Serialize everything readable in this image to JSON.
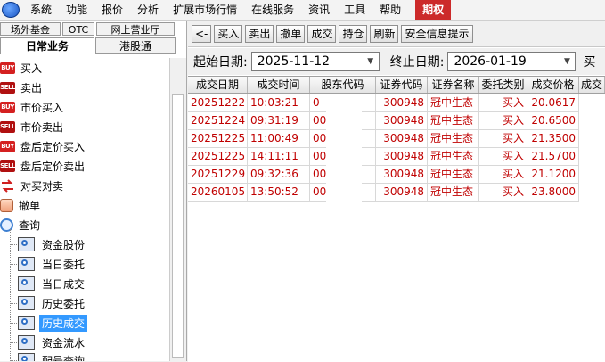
{
  "menu": {
    "items": [
      "系统",
      "功能",
      "报价",
      "分析",
      "扩展市场行情",
      "在线服务",
      "资讯",
      "工具",
      "帮助"
    ],
    "active": "期权"
  },
  "left_tabs": {
    "row1": [
      "场外基金",
      "OTC",
      "网上营业厅"
    ],
    "row2": [
      "日常业务",
      "港股通"
    ]
  },
  "tree": {
    "nodes": [
      {
        "label": "买入",
        "icon": "buy-icon"
      },
      {
        "label": "卖出",
        "icon": "sell-icon"
      },
      {
        "label": "市价买入",
        "icon": "buy-icon"
      },
      {
        "label": "市价卖出",
        "icon": "sell-icon"
      },
      {
        "label": "盘后定价买入",
        "icon": "buy-icon"
      },
      {
        "label": "盘后定价卖出",
        "icon": "sell-icon"
      },
      {
        "label": "对买对卖",
        "icon": "reverse-trade-icon"
      },
      {
        "label": "撤单",
        "icon": "cancel-order-icon"
      },
      {
        "label": "查询",
        "icon": "query-icon"
      }
    ],
    "leaves": [
      "资金股份",
      "当日委托",
      "当日成交",
      "历史委托",
      "历史成交",
      "资金流水",
      "配号查询"
    ],
    "selected_leaf": "历史成交"
  },
  "toolbar": {
    "buttons": [
      "<-",
      "买入",
      "卖出",
      "撤单",
      "成交",
      "持仓",
      "刷新",
      "安全信息提示"
    ]
  },
  "filters": {
    "start_label": "起始日期:",
    "start_value": "2025-11-12",
    "end_label": "终止日期:",
    "end_value": "2026-01-19",
    "trailing": "买"
  },
  "table": {
    "columns": [
      "成交日期",
      "成交时间",
      "股东代码",
      "证券代码",
      "证券名称",
      "委托类别",
      "成交价格",
      "成交"
    ],
    "rows": [
      [
        "20251222",
        "10:03:21",
        "0",
        "300948",
        "冠中生态",
        "买入",
        "20.0617"
      ],
      [
        "20251224",
        "09:31:19",
        "00",
        "300948",
        "冠中生态",
        "买入",
        "20.6500"
      ],
      [
        "20251225",
        "11:00:49",
        "00",
        "300948",
        "冠中生态",
        "买入",
        "21.3500"
      ],
      [
        "20251225",
        "14:11:11",
        "00",
        "300948",
        "冠中生态",
        "买入",
        "21.5700"
      ],
      [
        "20251229",
        "09:32:36",
        "00",
        "300948",
        "冠中生态",
        "买入",
        "21.1200"
      ],
      [
        "20260105",
        "13:50:52",
        "00",
        "300948",
        "冠中生态",
        "买入",
        "23.8000"
      ]
    ]
  },
  "colors": {
    "menu_active_bg": "#cc2a2a",
    "selection": "#3399ff",
    "row_text": "#c00000"
  }
}
